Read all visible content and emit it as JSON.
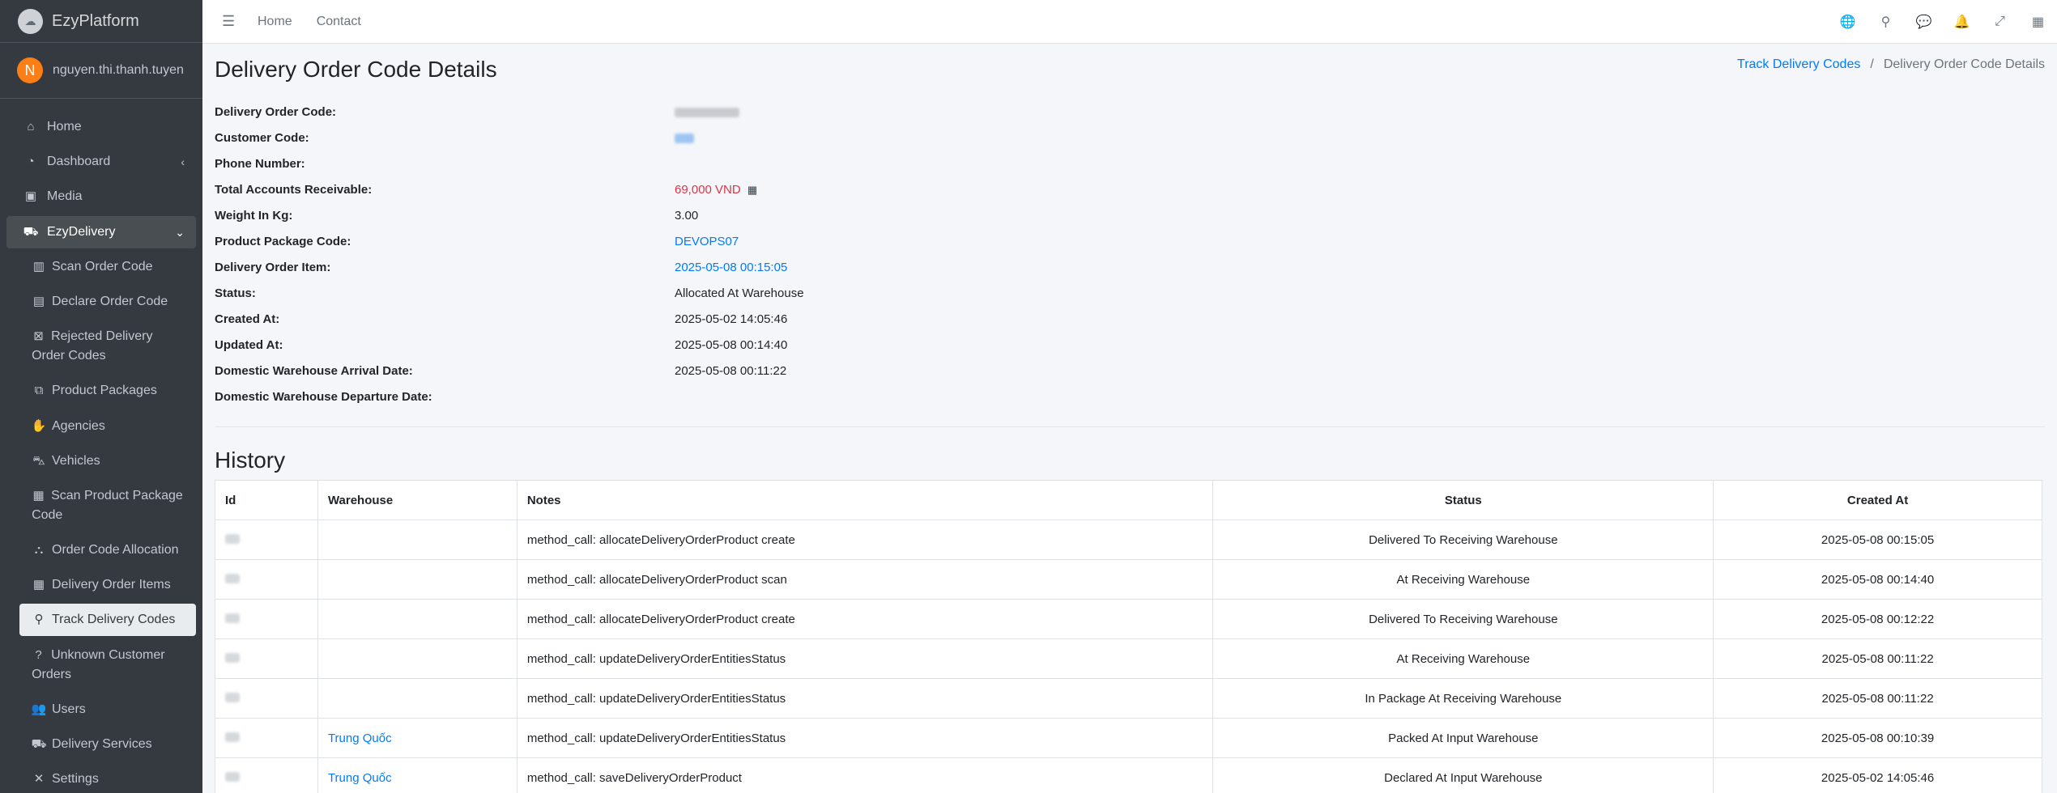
{
  "brand": {
    "name": "EzyPlatform",
    "logo_icon": "cloud-logo-icon"
  },
  "user": {
    "initial": "N",
    "name": "nguyen.thi.thanh.tuyen"
  },
  "sidebar": {
    "items": [
      {
        "label": "Home",
        "icon": "home-icon"
      },
      {
        "label": "Dashboard",
        "icon": "dashboard-icon"
      },
      {
        "label": "Media",
        "icon": "image-icon"
      },
      {
        "label": "EzyDelivery",
        "icon": "truck-icon"
      },
      {
        "label": "Scan Order Code",
        "icon": "barcode-icon"
      },
      {
        "label": "Declare Order Code",
        "icon": "file-icon"
      },
      {
        "label_line1": "Rejected Delivery",
        "label_line2": "Order Codes",
        "icon": "square-x-icon"
      },
      {
        "label": "Product Packages",
        "icon": "boxes-icon"
      },
      {
        "label": "Agencies",
        "icon": "handshake-icon"
      },
      {
        "label": "Vehicles",
        "icon": "car-icon"
      },
      {
        "label_line1": "Scan Product Package",
        "label_line2": "Code",
        "icon": "qrcode-icon"
      },
      {
        "label": "Order Code Allocation",
        "icon": "sitemap-icon"
      },
      {
        "label": "Delivery Order Items",
        "icon": "grid-icon"
      },
      {
        "label": "Track Delivery Codes",
        "icon": "search-icon"
      },
      {
        "label_line1": "Unknown Customer",
        "label_line2": "Orders",
        "icon": "question-icon"
      },
      {
        "label": "Users",
        "icon": "users-icon"
      },
      {
        "label": "Delivery Services",
        "icon": "truck-icon"
      },
      {
        "label": "Settings",
        "icon": "tools-icon"
      }
    ]
  },
  "topnav": {
    "home": "Home",
    "contact": "Contact"
  },
  "page": {
    "title": "Delivery Order Code Details",
    "breadcrumb": {
      "parent": "Track Delivery Codes",
      "current": "Delivery Order Code Details"
    }
  },
  "details": {
    "labels": {
      "delivery_order_code": "Delivery Order Code:",
      "customer_code": "Customer Code:",
      "phone_number": "Phone Number:",
      "total_accounts_receivable": "Total Accounts Receivable:",
      "weight_in_kg": "Weight In Kg:",
      "product_package_code": "Product Package Code:",
      "delivery_order_item": "Delivery Order Item:",
      "status": "Status:",
      "created_at": "Created At:",
      "updated_at": "Updated At:",
      "domestic_arrival": "Domestic Warehouse Arrival Date:",
      "domestic_departure": "Domestic Warehouse Departure Date:"
    },
    "values": {
      "total_accounts_receivable": "69,000 VND",
      "weight_in_kg": "3.00",
      "product_package_code": "DEVOPS07",
      "delivery_order_item": "2025-05-08 00:15:05",
      "status": "Allocated At Warehouse",
      "created_at": "2025-05-02 14:05:46",
      "updated_at": "2025-05-08 00:14:40",
      "domestic_arrival": "2025-05-08 00:11:22"
    }
  },
  "history": {
    "title": "History",
    "columns": {
      "id": "Id",
      "warehouse": "Warehouse",
      "notes": "Notes",
      "status": "Status",
      "created_at": "Created At"
    },
    "rows": [
      {
        "warehouse": "",
        "notes": "method_call: allocateDeliveryOrderProduct create",
        "status": "Delivered To Receiving Warehouse",
        "created_at": "2025-05-08 00:15:05"
      },
      {
        "warehouse": "",
        "notes": "method_call: allocateDeliveryOrderProduct scan",
        "status": "At Receiving Warehouse",
        "created_at": "2025-05-08 00:14:40"
      },
      {
        "warehouse": "",
        "notes": "method_call: allocateDeliveryOrderProduct create",
        "status": "Delivered To Receiving Warehouse",
        "created_at": "2025-05-08 00:12:22"
      },
      {
        "warehouse": "",
        "notes": "method_call: updateDeliveryOrderEntitiesStatus",
        "status": "At Receiving Warehouse",
        "created_at": "2025-05-08 00:11:22"
      },
      {
        "warehouse": "",
        "notes": "method_call: updateDeliveryOrderEntitiesStatus",
        "status": "In Package At Receiving Warehouse",
        "created_at": "2025-05-08 00:11:22"
      },
      {
        "warehouse": "Trung Quốc",
        "notes": "method_call: updateDeliveryOrderEntitiesStatus",
        "status": "Packed At Input Warehouse",
        "created_at": "2025-05-08 00:10:39"
      },
      {
        "warehouse": "Trung Quốc",
        "notes": "method_call: saveDeliveryOrderProduct",
        "status": "Declared At Input Warehouse",
        "created_at": "2025-05-02 14:05:46"
      }
    ]
  },
  "colors": {
    "sidebar_bg": "#343a40",
    "link": "#007bff",
    "amount": "#dc3545",
    "avatar": "#fd7e14"
  }
}
